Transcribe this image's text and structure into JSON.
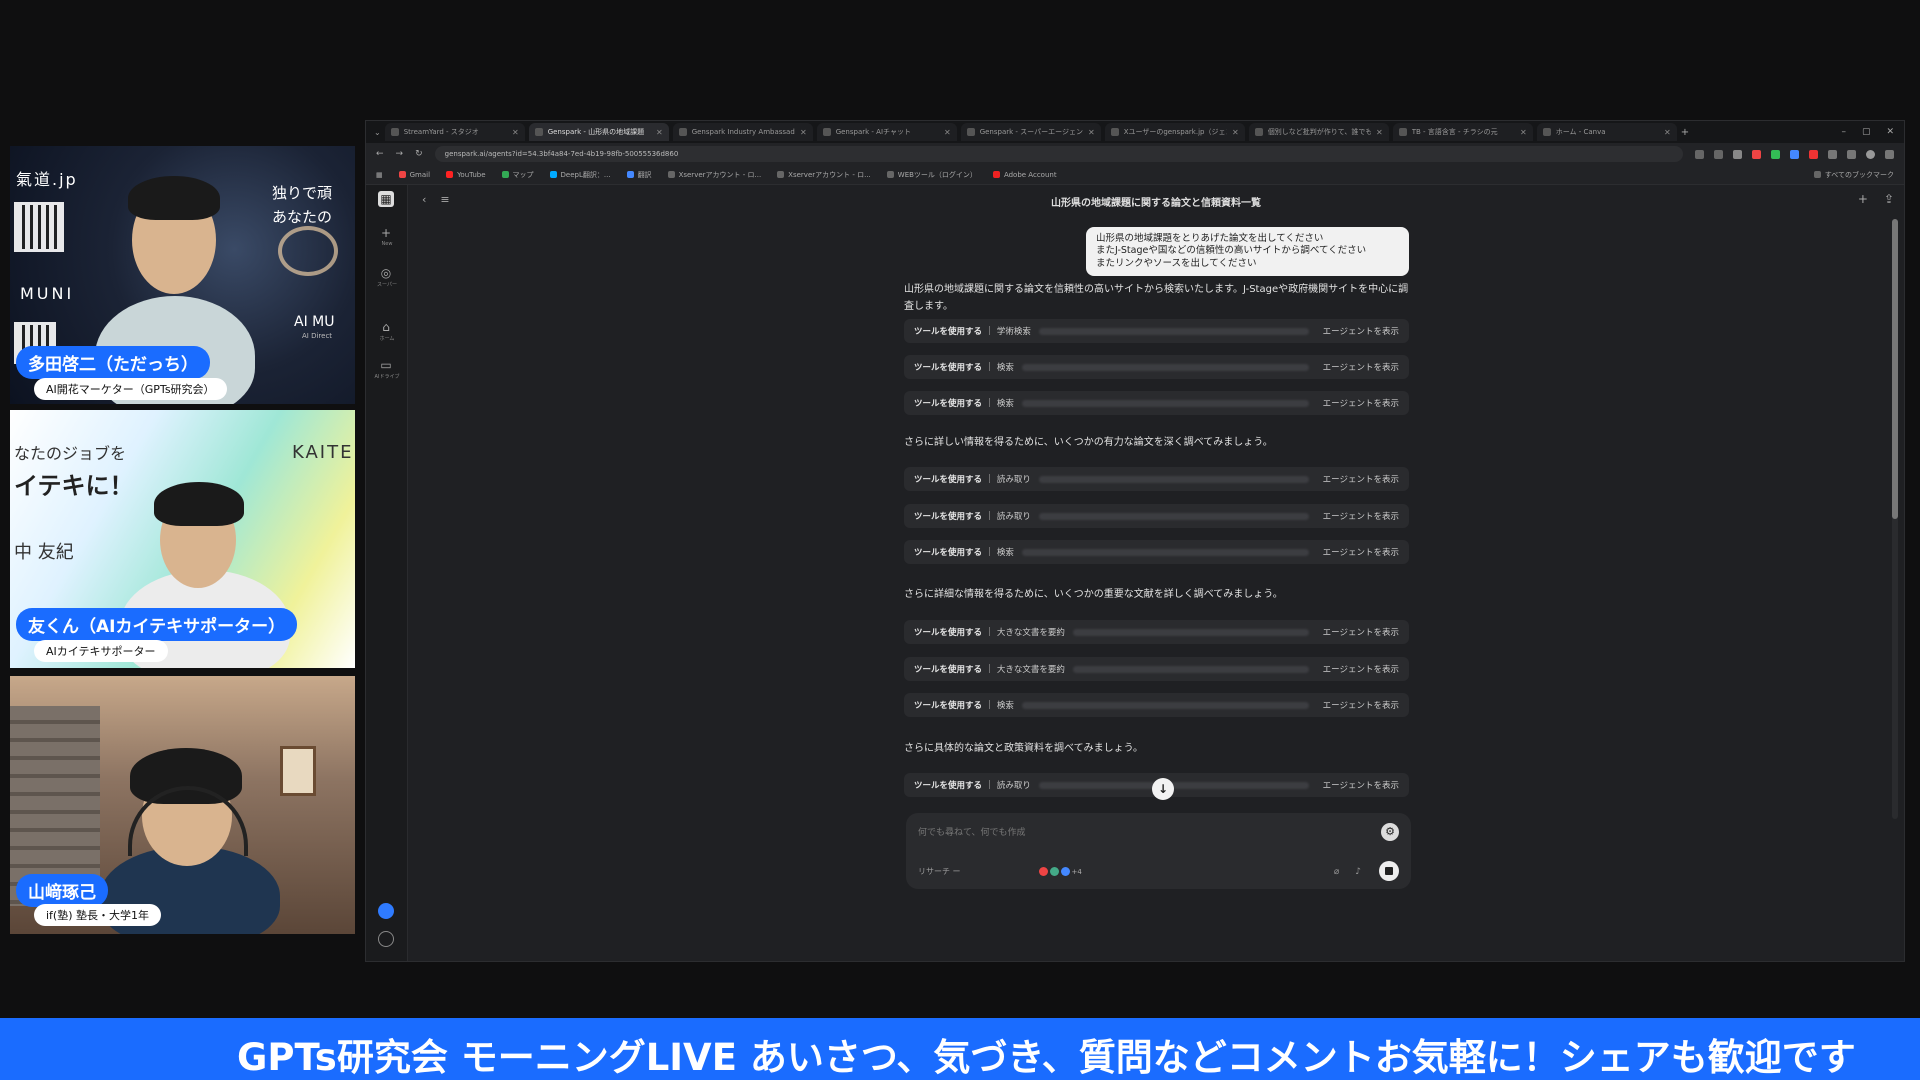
{
  "participants": [
    {
      "name": "多田啓二（ただっち）",
      "role": "AI開花マーケター（GPTs研究会）",
      "bg_texts": [
        "氣道.jp",
        "独りで頑",
        "あなたの",
        "MUNI",
        "AI MU",
        "AI Direct"
      ]
    },
    {
      "name": "友くん（AIカイテキサポーター）",
      "role": "AIカイテキサポーター",
      "bg_texts": [
        "なたのジョブを",
        "イテキに！",
        "KAITE",
        "中 友紀"
      ]
    },
    {
      "name": "山﨑琢己",
      "role": "if(塾) 塾長・大学1年"
    }
  ],
  "browser": {
    "tabs": [
      {
        "label": "StreamYard - スタジオ"
      },
      {
        "label": "Genspark - 山形県の地域課題",
        "active": true
      },
      {
        "label": "Genspark Industry Ambassado"
      },
      {
        "label": "Genspark - AIチャット"
      },
      {
        "label": "Genspark - スーパーエージェント"
      },
      {
        "label": "Xユーザーのgenspark.jp（ジェンスパ"
      },
      {
        "label": "個別しなど批判が作りて、誰でも"
      },
      {
        "label": "TB - 言語含言 - チラシの元"
      },
      {
        "label": "ホーム - Canva"
      }
    ],
    "url": "genspark.ai/agents?id=54.3bf4a84-7ed-4b19-98fb-50055536d860",
    "bookmarks": [
      "Gmail",
      "YouTube",
      "マップ",
      "DeepL翻訳：...",
      "翻訳",
      "Xserverアカウント - ロ...",
      "Xserverアカウント - ロ...",
      "WEBツール（ログイン）",
      "Adobe Account"
    ],
    "bookmarks_right": "すべてのブックマーク"
  },
  "app": {
    "sidebar": [
      {
        "icon": "+",
        "label": "New"
      },
      {
        "icon": "◎",
        "label": "スーパー"
      },
      {
        "icon": "⌂",
        "label": "ホーム"
      },
      {
        "icon": "▭",
        "label": "AIドライブ"
      }
    ],
    "title": "山形県の地域課題に関する論文と信頼資料一覧",
    "user_message": [
      "山形県の地域課題をとりあげた論文を出してください",
      "またJ-Stageや国などの信頼性の高いサイトから調べてください",
      "またリンクやソースを出してください"
    ],
    "intro": "山形県の地域課題に関する論文を信頼性の高いサイトから検索いたします。J-Stageや政府機関サイトを中心に調査します。",
    "tool_label": "ツールを使用する",
    "agent_label": "エージェントを表示",
    "groups": [
      {
        "rows": [
          {
            "kind": "学術検索"
          },
          {
            "kind": "検索"
          },
          {
            "kind": "検索"
          }
        ]
      },
      {
        "heading": "さらに詳しい情報を得るために、いくつかの有力な論文を深く調べてみましょう。",
        "rows": [
          {
            "kind": "読み取り"
          },
          {
            "kind": "読み取り"
          },
          {
            "kind": "検索"
          }
        ]
      },
      {
        "heading": "さらに詳細な情報を得るために、いくつかの重要な文献を詳しく調べてみましょう。",
        "rows": [
          {
            "kind": "大きな文書を要約"
          },
          {
            "kind": "大きな文書を要約"
          },
          {
            "kind": "検索"
          }
        ]
      },
      {
        "heading": "さらに具体的な論文と政策資料を調べてみましょう。",
        "rows": [
          {
            "kind": "読み取り"
          }
        ]
      }
    ],
    "composer": {
      "placeholder": "何でも尋ねて、何でも作成",
      "mode": "リサーチ ー",
      "apps_count": "+4"
    }
  },
  "ticker": "GPTs研究会 モーニングLIVE あいさつ、気づき、質問などコメントお気軽に！シェアも歓迎です",
  "colors": {
    "accent": "#1a6cff",
    "app_bg": "#1f2023"
  }
}
